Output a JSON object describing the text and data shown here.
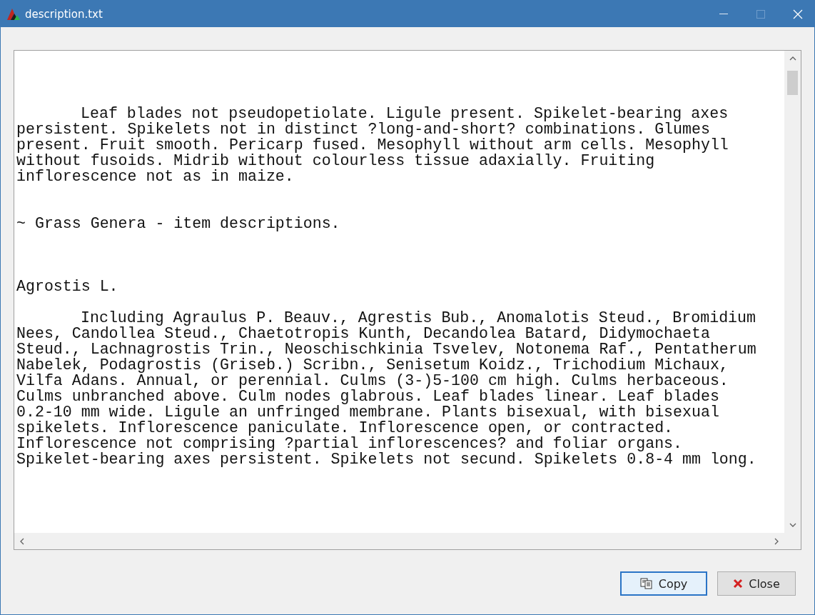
{
  "window": {
    "title": "description.txt"
  },
  "document": {
    "paragraphs": [
      {
        "indented": true,
        "lines": [
          "Leaf blades not pseudopetiolate. Ligule present. Spikelet-bearing axes",
          "persistent. Spikelets not in distinct ?long-and-short? combinations. Glumes",
          "present. Fruit smooth. Pericarp fused. Mesophyll without arm cells. Mesophyll",
          "without fusoids. Midrib without colourless tissue adaxially. Fruiting",
          "inflorescence not as in maize."
        ]
      },
      {
        "indented": false,
        "lines": [
          "~ Grass Genera - item descriptions."
        ]
      },
      {
        "indented": false,
        "lines": [
          "Agrostis L."
        ]
      },
      {
        "indented": true,
        "lines": [
          "Including Agraulus P. Beauv., Agrestis Bub., Anomalotis Steud., Bromidium",
          "Nees, Candollea Steud., Chaetotropis Kunth, Decandolea Batard, Didymochaeta",
          "Steud., Lachnagrostis Trin., Neoschischkinia Tsvelev, Notonema Raf., Pentatherum",
          "Nabelek, Podagrostis (Griseb.) Scribn., Senisetum Koidz., Trichodium Michaux,",
          "Vilfa Adans. Annual, or perennial. Culms (3-)5-100 cm high. Culms herbaceous.",
          "Culms unbranched above. Culm nodes glabrous. Leaf blades linear. Leaf blades",
          "0.2-10 mm wide. Ligule an unfringed membrane. Plants bisexual, with bisexual",
          "spikelets. Inflorescence paniculate. Inflorescence open, or contracted.",
          "Inflorescence not comprising ?partial inflorescences? and foliar organs.",
          "Spikelet-bearing axes persistent. Spikelets not secund. Spikelets 0.8-4 mm long."
        ]
      }
    ]
  },
  "buttons": [
    {
      "kind": "copy",
      "label": "Copy",
      "focused": true
    },
    {
      "kind": "close",
      "label": "Close",
      "focused": false
    }
  ]
}
